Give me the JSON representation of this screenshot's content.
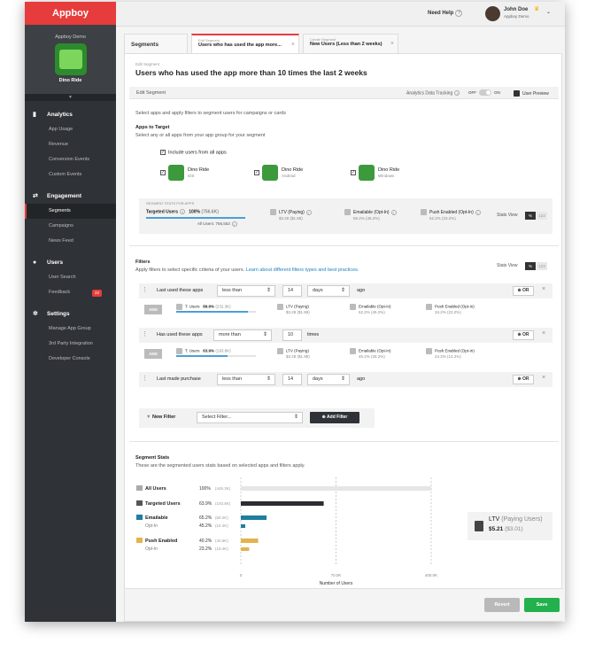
{
  "brand": "Appboy",
  "app": {
    "group": "Appboy Demo",
    "name": "Dino Ride"
  },
  "sidebar": [
    {
      "section": "Analytics",
      "icon": "bar-chart-icon",
      "items": [
        "App Usage",
        "Revenue",
        "Conversion Events",
        "Custom Events"
      ]
    },
    {
      "section": "Engagement",
      "icon": "exchange-icon",
      "items": [
        "Segments",
        "Campaigns",
        "News Feed"
      ]
    },
    {
      "section": "Users",
      "icon": "user-icon",
      "items": [
        "User Search",
        "Feedback"
      ]
    },
    {
      "section": "Settings",
      "icon": "gears-icon",
      "items": [
        "Manage App Group",
        "3rd Party Integration",
        "Developer Console"
      ]
    }
  ],
  "feedback_badge": "22",
  "header": {
    "need_help": "Need Help",
    "help_mark": "?",
    "user_name": "John Doe",
    "user_org": "Appboy Demo"
  },
  "tabs": [
    {
      "small": "",
      "label": "Segments"
    },
    {
      "small": "Edit Segment",
      "label": "Users who has used the app more..."
    },
    {
      "small": "Create Segment",
      "label": "New Users (Less than 2 weeks)"
    }
  ],
  "page": {
    "small": "Edit Segment",
    "title": "Users who has used the app more than 10 times the last 2 weeks",
    "bar_label": "Edit Segment",
    "tracking": "Analytics Data Tracking",
    "off": "OFF",
    "on": "ON",
    "preview": "User Preview",
    "intro": "Select apps and apply filters  to segment users for campaigns or cards",
    "apps_title": "Apps to Target",
    "apps_sub": "Select any or all apps from your app group for your segment",
    "include_all": "Include users from all apps"
  },
  "apps": [
    {
      "name": "Dino Ride",
      "platform": "iOS"
    },
    {
      "name": "Dino Ride",
      "platform": "Android"
    },
    {
      "name": "Dino Ride",
      "platform": "Windows"
    }
  ],
  "seg_stats": {
    "label": "SEGMENT STATS FOR APPS",
    "targeted": "Targeted Users",
    "targeted_pct": "100%",
    "targeted_n": "(756.6K)",
    "all_users": "All Users: 756,553",
    "ltv": "LTV (Paying)",
    "ltv_v": "$3.28 ($1.88)",
    "emailable": "Emailable (Opt-In)",
    "emailable_v": "65.2% (45.2%)",
    "push": "Push Enabled (Opt-In)",
    "push_v": "52.2% (23.2%)",
    "stats_view": "Stats View",
    "pct": "%",
    "num": "123"
  },
  "filters": {
    "title": "Filters",
    "sub": "Apply filters to select specific criteria of your users.",
    "link": "Learn about different filters types and best practices.",
    "stats_view": "Stats View",
    "pct": "%",
    "num": "123",
    "rows": [
      {
        "label": "Last used these apps",
        "op": "less than",
        "num": "14",
        "unit": "days",
        "suffix": "ago",
        "t_pct": "89.9%",
        "t_n": "(232.3K)",
        "fill": 0.899,
        "ltv_v": "$3.28 ($1.88)",
        "email_v": "62.2% (45.2%)",
        "push_v": "34.2% (23.2%)"
      },
      {
        "label": "Has used these apps",
        "op": "more than",
        "num": "10",
        "unit": "",
        "suffix": "times",
        "t_pct": "63.9%",
        "t_n": "(193.8K)",
        "fill": 0.639,
        "ltv_v": "$3.28 ($1.88)",
        "email_v": "45.2% (25.2%)",
        "push_v": "24.2% (13.2%)"
      },
      {
        "label": "Last made purchase",
        "op": "less than",
        "num": "14",
        "unit": "days",
        "suffix": "ago"
      }
    ],
    "and": "AND",
    "or": "OR",
    "close": "×",
    "t_users": "T. Users",
    "ltv": "LTV (Paying)",
    "email": "Emailable (Opt-In)",
    "push": "Push Enabled (Opt-In)",
    "new_filter": "New Filter",
    "select_filter": "Select Filter...",
    "add_filter": "Add Filter"
  },
  "segment_stats": {
    "title": "Segment Stats",
    "sub": "These are the segmented users stats based on selected apps and filters apply."
  },
  "chart_data": {
    "type": "bar",
    "categories": [
      "All Users",
      "Targeted Users",
      "Emailable",
      "Opt-In",
      "Push Enabled",
      "Opt-In"
    ],
    "values": [
      445300,
      193800,
      60200,
      10400,
      40500,
      19400
    ],
    "labels": [
      "100%",
      "63.9%",
      "65.2%",
      "45.2%",
      "40.2%",
      "23.2%"
    ],
    "counts": [
      "(445.3K)",
      "(193.8K)",
      "(60.2K)",
      "(10.4K)",
      "(40.5K)",
      "(19.4K)"
    ],
    "colors": [
      "#e6e6e6",
      "#2b2d30",
      "#1f7ea0",
      "#1f7ea0",
      "#e3b34d",
      "#e3b34d"
    ],
    "xticks": [
      "0",
      "70.0K",
      "400.0K"
    ],
    "xlabel": "Number of Users",
    "xlim": [
      0,
      445300
    ]
  },
  "ltv_box": {
    "label": "LTV",
    "paren": "(Paying Users)",
    "value": "$5.21",
    "sub": "($3.01)"
  },
  "footer": {
    "revert": "Revert",
    "save": "Save"
  }
}
